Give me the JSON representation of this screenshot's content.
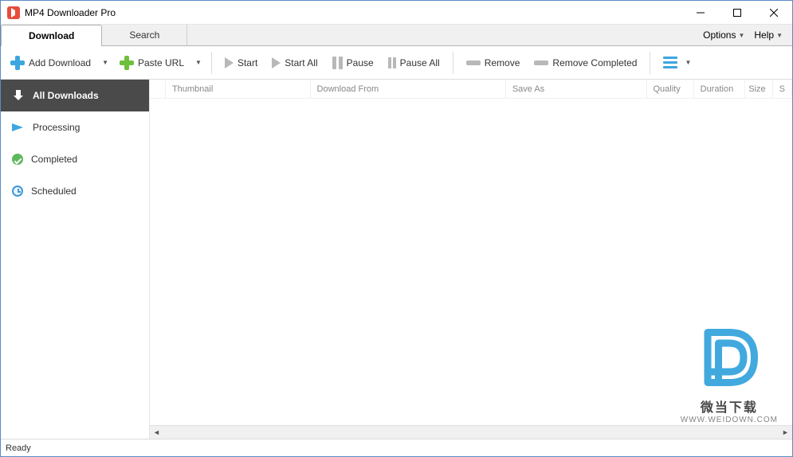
{
  "app": {
    "title": "MP4 Downloader Pro"
  },
  "tabs": {
    "download": "Download",
    "search": "Search"
  },
  "menus": {
    "options": "Options",
    "help": "Help"
  },
  "toolbar": {
    "add_download": "Add Download",
    "paste_url": "Paste URL",
    "start": "Start",
    "start_all": "Start All",
    "pause": "Pause",
    "pause_all": "Pause All",
    "remove": "Remove",
    "remove_completed": "Remove Completed"
  },
  "sidebar": {
    "all_downloads": "All Downloads",
    "processing": "Processing",
    "completed": "Completed",
    "scheduled": "Scheduled"
  },
  "columns": {
    "thumbnail": "Thumbnail",
    "download_from": "Download From",
    "save_as": "Save As",
    "quality": "Quality",
    "duration": "Duration",
    "size": "Size",
    "s": "S"
  },
  "status": {
    "ready": "Ready"
  },
  "watermark": {
    "line1": "微当下载",
    "line2": "WWW.WEIDOWN.COM"
  }
}
